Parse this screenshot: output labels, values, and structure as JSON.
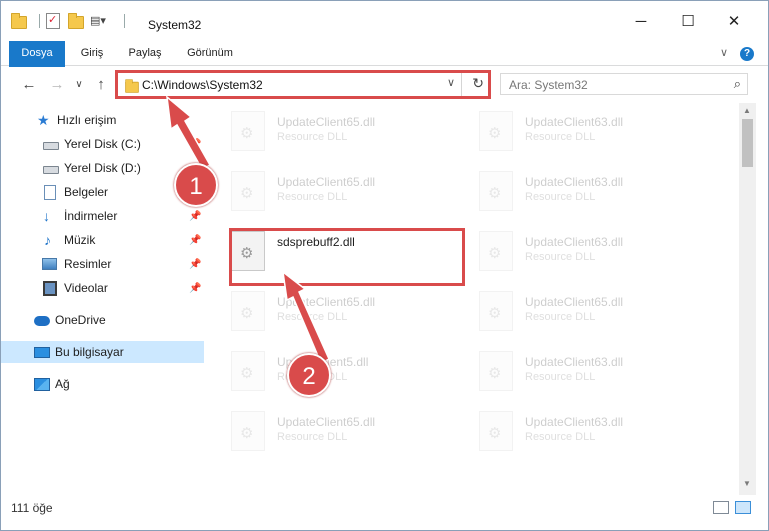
{
  "window": {
    "title": "System32",
    "controls": {
      "minimize": "─",
      "maximize": "☐",
      "close": "✕"
    }
  },
  "ribbon": {
    "tabs": [
      "Dosya",
      "Giriş",
      "Paylaş",
      "Görünüm"
    ],
    "help": "?",
    "collapse": "∨"
  },
  "address": {
    "back": "←",
    "forward": "→",
    "recent": "∨",
    "up": "↑",
    "path": "C:\\Windows\\System32",
    "dropdown": "∨",
    "refresh": "↻"
  },
  "search": {
    "placeholder": "Ara: System32",
    "icon": "⌕"
  },
  "nav": {
    "pin": "📌",
    "items": [
      {
        "label": "Hızlı erişim",
        "icon": "star-icon"
      },
      {
        "label": "Yerel Disk (C:)",
        "icon": "drive-icon",
        "pinned": true
      },
      {
        "label": "Yerel Disk (D:)",
        "icon": "drive-icon"
      },
      {
        "label": "Belgeler",
        "icon": "document-icon"
      },
      {
        "label": "İndirmeler",
        "icon": "download-icon",
        "pinned": true
      },
      {
        "label": "Müzik",
        "icon": "music-icon",
        "pinned": true
      },
      {
        "label": "Resimler",
        "icon": "pictures-icon",
        "pinned": true
      },
      {
        "label": "Videolar",
        "icon": "video-icon",
        "pinned": true
      },
      {
        "label": "OneDrive",
        "icon": "cloud-icon"
      },
      {
        "label": "Bu bilgisayar",
        "icon": "computer-icon",
        "selected": true
      },
      {
        "label": "Ağ",
        "icon": "network-icon"
      }
    ]
  },
  "files": [
    {
      "name": "UpdateClient65.dll",
      "type": "Resource DLL",
      "faded": true
    },
    {
      "name": "UpdateClient63.dll",
      "type": "Resource DLL",
      "faded": true
    },
    {
      "name": "UpdateClient65.dll",
      "type": "Resource DLL",
      "faded": true
    },
    {
      "name": "UpdateClient63.dll",
      "type": "Resource DLL",
      "faded": true
    },
    {
      "name": "sdsprebuff2.dll",
      "type": "",
      "faded": false
    },
    {
      "name": "UpdateClient63.dll",
      "type": "Resource DLL",
      "faded": true
    },
    {
      "name": "UpdateClient65.dll",
      "type": "Resource DLL",
      "faded": true
    },
    {
      "name": "UpdateClient65.dll",
      "type": "Resource DLL",
      "faded": true
    },
    {
      "name": "UpdateClient65.dll",
      "type": "Resource DLL",
      "faded": true
    },
    {
      "name": "UpdateClient5.dll",
      "type": "Resource DLL",
      "faded": true
    },
    {
      "name": "UpdateClient63.dll",
      "type": "Resource DLL",
      "faded": true
    },
    {
      "name": "UpdateClient65.dll",
      "type": "Resource DLL",
      "faded": true
    },
    {
      "name": "UpdateClient63.dll",
      "type": "Resource DLL",
      "faded": true
    }
  ],
  "status": {
    "count": "111 öğe"
  },
  "scrollbar": {
    "up": "▲",
    "down": "▼"
  },
  "annotations": {
    "step1": "1",
    "step2": "2",
    "color": "#d94b4b"
  }
}
